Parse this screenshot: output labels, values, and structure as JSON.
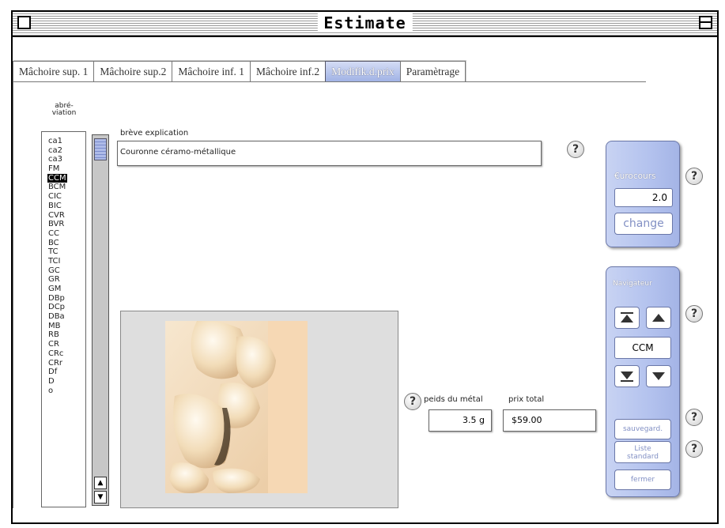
{
  "window": {
    "title": "Estimate"
  },
  "tabs": [
    {
      "label": "Mâchoire sup. 1",
      "active": false
    },
    {
      "label": "Mâchoire sup.2",
      "active": false
    },
    {
      "label": "Mâchoire inf. 1",
      "active": false
    },
    {
      "label": "Mâchoire inf.2",
      "active": false
    },
    {
      "label": "Modifik.d.prix",
      "active": true
    },
    {
      "label": "Paramètrage",
      "active": false
    }
  ],
  "abbrev": {
    "header_line1": "abré-",
    "header_line2": "viation",
    "items": [
      "ca1",
      "ca2",
      "ca3",
      "FM",
      "CCM",
      "BCM",
      "CIC",
      "BIC",
      "CVR",
      "BVR",
      "CC",
      "BC",
      "TC",
      "TCI",
      "GC",
      "GR",
      "GM",
      "DBp",
      "DCp",
      "DBa",
      "MB",
      "RB",
      "CR",
      "CRc",
      "CRr",
      "Df",
      "D",
      "o"
    ],
    "selected": "CCM"
  },
  "breve": {
    "label": "brève explication",
    "value": "Couronne céramo-métallique"
  },
  "poids": {
    "label": "peids du métal",
    "value": "3.5 g"
  },
  "prix": {
    "label": "prix total",
    "value": "$59.00"
  },
  "eurocours": {
    "caption": "€urocours",
    "value": "2.0",
    "change_label": "change"
  },
  "navigator": {
    "caption": "Navigateur",
    "current": "CCM",
    "save_label": "sauvegard.",
    "liste_label_1": "Liste",
    "liste_label_2": "standard",
    "fermer_label": "fermer"
  },
  "help_glyph": "?"
}
